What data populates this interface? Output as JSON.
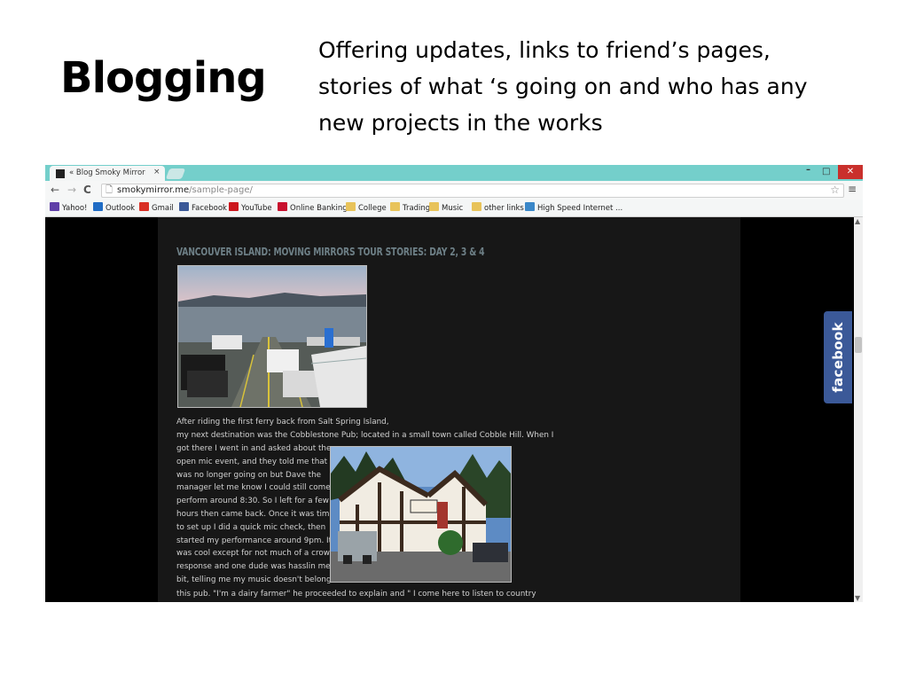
{
  "slide": {
    "title": "Blogging",
    "text": "Offering updates, links to friend’s pages, stories of what ‘s going on and who has any new projects in the works"
  },
  "browser": {
    "tab_title": "« Blog Smoky Mirror",
    "tab_close": "×",
    "url_host": "smokymirror.me",
    "url_path": "/sample-page/",
    "window_controls": {
      "minimize": "–",
      "maximize": "□",
      "close": "✕"
    },
    "bookmarks": [
      {
        "label": "Yahoo!",
        "icon": "yahoo-mail-icon",
        "color": "#5f3fa8"
      },
      {
        "label": "Outlook",
        "icon": "outlook-icon",
        "color": "#1f6cc5"
      },
      {
        "label": "Gmail",
        "icon": "gmail-icon",
        "color": "#d93025"
      },
      {
        "label": "Facebook",
        "icon": "facebook-icon",
        "color": "#3b5998"
      },
      {
        "label": "YouTube",
        "icon": "youtube-icon",
        "color": "#cc181e"
      },
      {
        "label": "Online Banking",
        "icon": "bank-icon",
        "color": "#c8102e"
      },
      {
        "label": "College",
        "icon": "folder-icon",
        "color": "#e8c35a"
      },
      {
        "label": "Trading",
        "icon": "folder-icon",
        "color": "#e8c35a"
      },
      {
        "label": "Music",
        "icon": "folder-icon",
        "color": "#e8c35a"
      },
      {
        "label": "other links",
        "icon": "folder-icon",
        "color": "#e8c35a"
      },
      {
        "label": "High Speed Internet ...",
        "icon": "globe-icon",
        "color": "#3a87c8"
      }
    ]
  },
  "page": {
    "post_title": "VANCOUVER ISLAND: MOVING MIRRORS TOUR STORIES: DAY 2, 3 & 4",
    "intro_lines": [
      "After riding the first ferry back from Salt Spring Island,",
      "my next destination was the Cobblestone Pub; located in a small town called Cobble Hill. When I"
    ],
    "wrap_lines": [
      "got there I went in and asked about the",
      "open mic event, and they told me that it",
      "was no longer going on but Dave the",
      "manager let me know I could still come",
      "perform around 8:30. So I left for a few",
      "hours then came back. Once it was time",
      "to set up I did a quick mic check, then",
      "started my performance around 9pm. It",
      "was cool except for not much of a crowd",
      "response and one dude was hasslin me a",
      "bit, telling me my music doesn't belong at"
    ],
    "last_line": "this pub. \"I'm a dairy farmer\" he proceeded to explain and \" I come here to listen to country",
    "facebook_tab": "facebook"
  }
}
